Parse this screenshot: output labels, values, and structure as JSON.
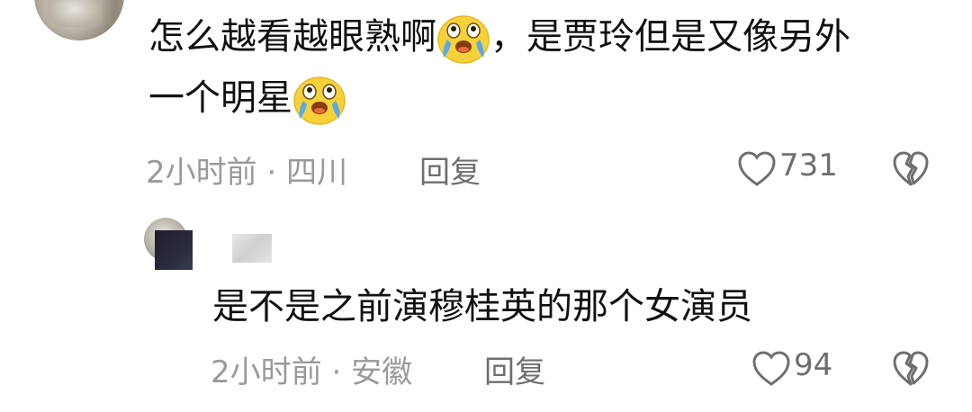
{
  "comment": {
    "text_line1": "怎么越看越眼熟啊",
    "text_line1_after_emoji": "，是贾玲但是又像另外",
    "text_line2": "一个明星",
    "emoji_name": "crying-laughing-face-icon",
    "time": "2小时前",
    "dot": "·",
    "location": "四川",
    "reply_label": "回复",
    "like_count": "731"
  },
  "reply": {
    "text": "是不是之前演穆桂英的那个女演员",
    "time": "2小时前",
    "dot": "·",
    "location": "安徽",
    "reply_label": "回复",
    "like_count": "94"
  },
  "colors": {
    "text": "#111111",
    "meta": "#9a9a9a",
    "action": "#6f6f6f",
    "emoji_face": "#f6d23a",
    "emoji_tears": "#5aa9e6"
  }
}
